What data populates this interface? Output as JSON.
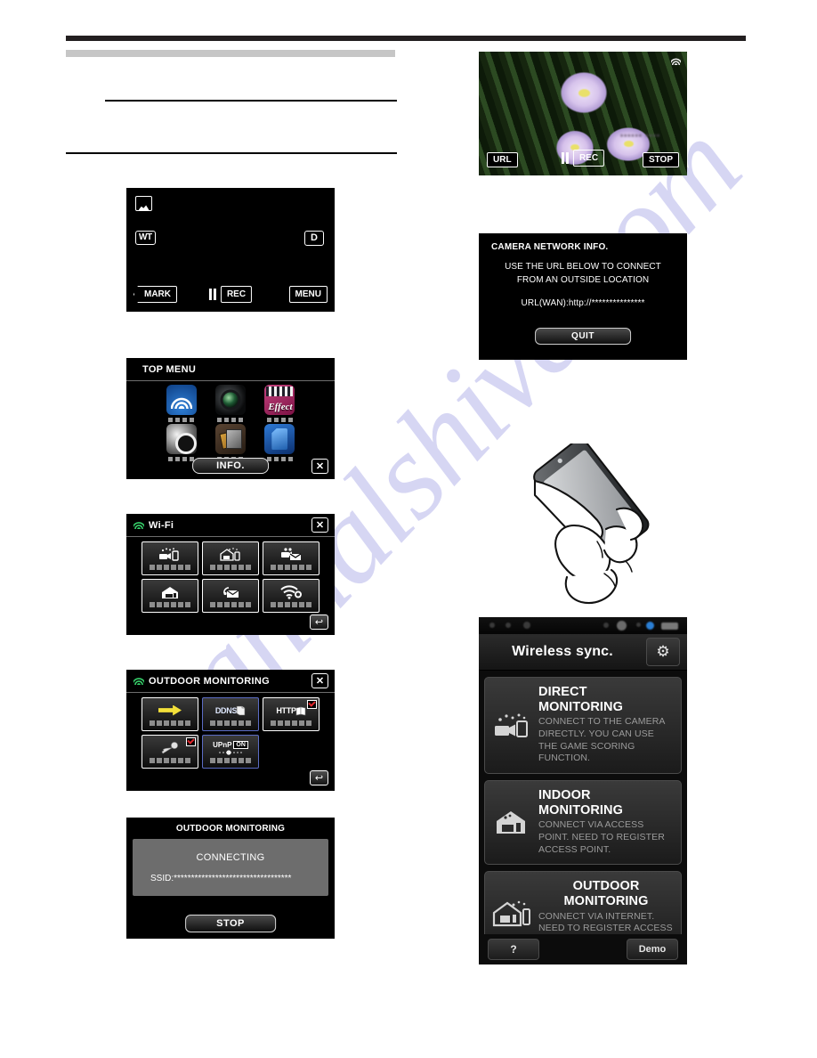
{
  "document": {
    "watermark": "manualshive.com"
  },
  "rec_standby_screen": {
    "name": "record-standby",
    "top_left_icon": "scene-mountain-icon",
    "zoom_label": "WT",
    "mode_label": "D",
    "mark_label": "MARK",
    "rec_label": "REC",
    "menu_label": "MENU"
  },
  "top_menu_screen": {
    "title": "TOP MENU",
    "tiles": [
      {
        "icon": "wifi-icon",
        "label_redacted": true
      },
      {
        "icon": "camera-lens-icon",
        "label_redacted": true
      },
      {
        "icon": "special-effect-icon",
        "label_redacted": true
      },
      {
        "icon": "settings-gear-icon",
        "label_redacted": true
      },
      {
        "icon": "media-settings-icon",
        "label_redacted": true
      },
      {
        "icon": "sd-card-icon",
        "label_redacted": true
      }
    ],
    "info_label": "INFO.",
    "close_label": "✕"
  },
  "wifi_screen": {
    "title": "Wi-Fi",
    "status_icon": "wifi-signal-icon",
    "close_label": "✕",
    "back_label": "↩",
    "tiles": [
      {
        "icon": "direct-monitoring-icon"
      },
      {
        "icon": "indoor-monitoring-icon"
      },
      {
        "icon": "video-mail-icon"
      },
      {
        "icon": "detect-mail-house-icon"
      },
      {
        "icon": "detect-mail-icon"
      },
      {
        "icon": "wifi-settings-icon"
      }
    ]
  },
  "outdoor_screen": {
    "title": "OUTDOOR MONITORING",
    "status_icon": "wifi-signal-icon",
    "close_label": "✕",
    "back_label": "↩",
    "tiles": [
      {
        "icon": "yellow-arrow-icon",
        "text": "",
        "checked": false
      },
      {
        "icon": "ddns-icon",
        "text": "DDNS",
        "checked": false
      },
      {
        "icon": "http-icon",
        "text": "HTTP",
        "checked": true
      },
      {
        "icon": "key-icon",
        "text": "",
        "checked": true
      },
      {
        "icon": "upnp-icon",
        "text": "UPnP",
        "toggle": "ON",
        "checked": false
      }
    ]
  },
  "connecting_screen": {
    "title": "OUTDOOR MONITORING",
    "state": "CONNECTING",
    "ssid_label": "SSID:",
    "ssid_value": "**********************************",
    "stop_label": "STOP"
  },
  "flower_preview_screen": {
    "wifi_icon": "wifi-signal-icon",
    "url_label": "URL",
    "rec_label": "REC",
    "stop_label": "STOP",
    "obscured_overlay": "••••••  ••••"
  },
  "network_info_screen": {
    "title": "CAMERA NETWORK INFO.",
    "body_line1": "USE THE URL BELOW TO CONNECT",
    "body_line2": "FROM AN OUTSIDE LOCATION",
    "url_line": "URL(WAN):http://***************",
    "quit_label": "QUIT"
  },
  "phone_app_screen": {
    "app_title": "Wireless sync.",
    "settings_icon": "gear-icon",
    "modes": [
      {
        "icon": "direct-monitoring-icon",
        "title": "DIRECT MONITORING",
        "desc": "CONNECT TO THE CAMERA DIRECTLY. YOU CAN USE THE GAME SCORING FUNCTION.",
        "title_centered": false
      },
      {
        "icon": "indoor-monitoring-icon",
        "title": "INDOOR MONITORING",
        "desc": "CONNECT VIA ACCESS POINT. NEED TO REGISTER ACCESS POINT.",
        "title_centered": false
      },
      {
        "icon": "outdoor-monitoring-icon",
        "title": "OUTDOOR MONITORING",
        "desc": "CONNECT VIA INTERNET. NEED TO REGISTER ACCESS POINT AND DDNS.",
        "title_centered": true
      }
    ],
    "help_label": "?",
    "demo_label": "Demo"
  }
}
